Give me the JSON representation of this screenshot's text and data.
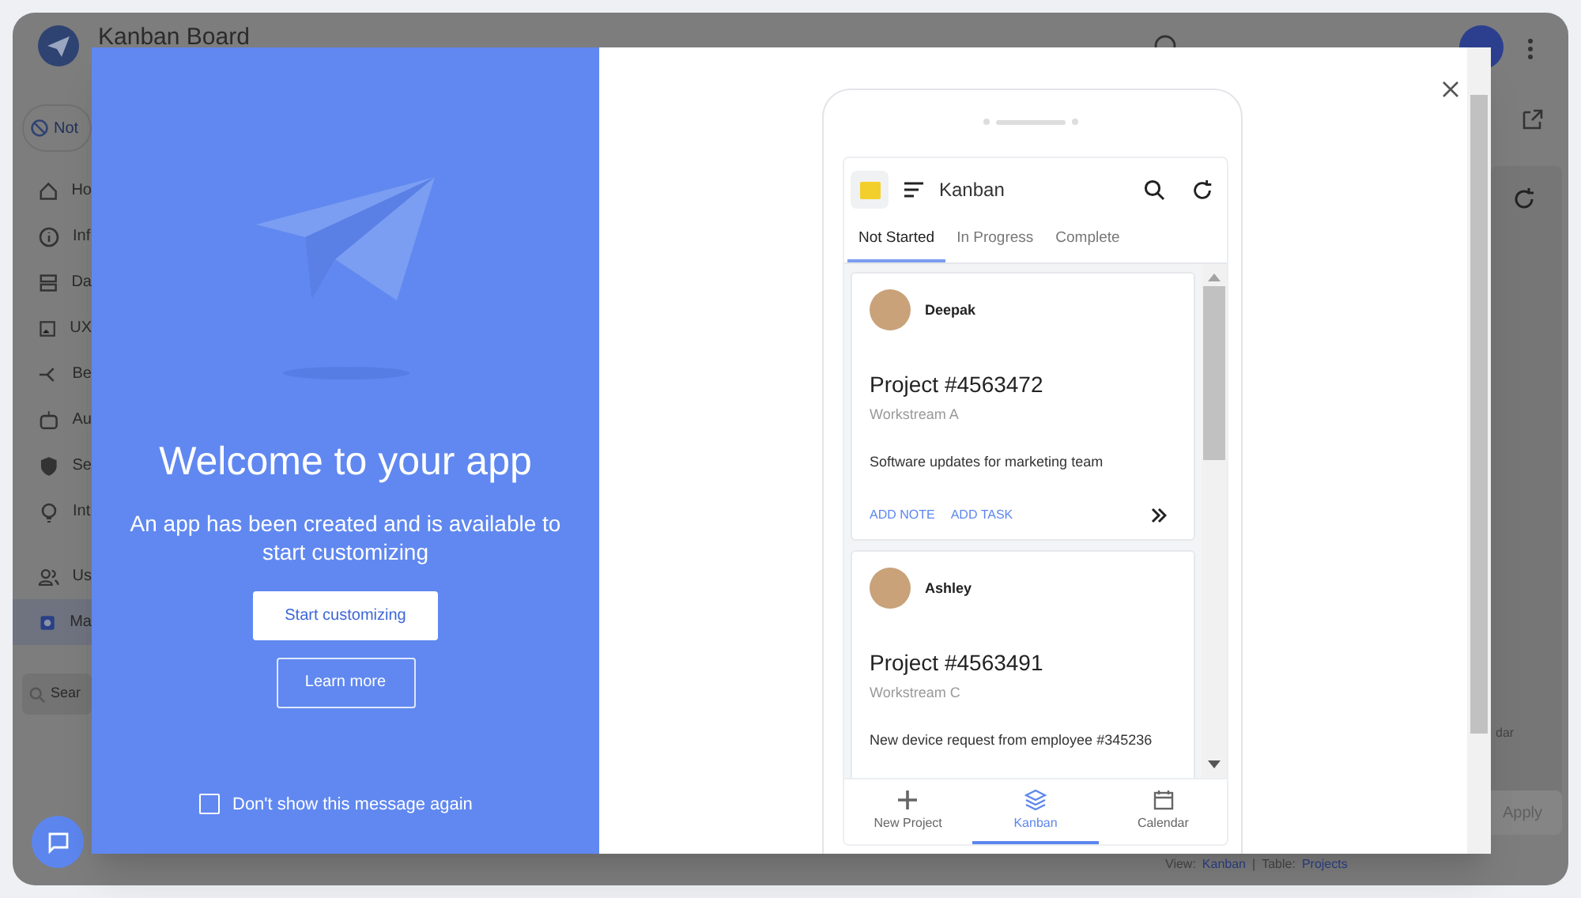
{
  "background_app": {
    "title": "Kanban Board",
    "status_chip": "Not",
    "sidebar": {
      "items": [
        {
          "label": "Ho",
          "selected": false
        },
        {
          "label": "Inf",
          "selected": false
        },
        {
          "label": "Da",
          "selected": false
        },
        {
          "label": "UX",
          "selected": false
        },
        {
          "label": "Be",
          "selected": false
        },
        {
          "label": "Au",
          "selected": false
        },
        {
          "label": "Se",
          "selected": false
        },
        {
          "label": "Int",
          "selected": false
        },
        {
          "label": "Us",
          "selected": false
        },
        {
          "label": "Ma",
          "selected": true
        }
      ],
      "search_placeholder": "Sear"
    },
    "preview": {
      "nav_label": "dar",
      "apply_button": "Apply",
      "view_label": "View:",
      "view": "Kanban",
      "separator": "|",
      "table_label": "Table:",
      "table": "Projects"
    }
  },
  "modal": {
    "title": "Welcome to your app",
    "message": "An app has been created and is available to start customizing",
    "primary_button": "Start customizing",
    "secondary_button": "Learn more",
    "dont_show": {
      "label": "Don't show this message again",
      "checked": false
    },
    "phone": {
      "app_title": "Kanban",
      "tabs": [
        {
          "label": "Not Started",
          "selected": true
        },
        {
          "label": "In Progress",
          "selected": false
        },
        {
          "label": "Complete",
          "selected": false
        }
      ],
      "cards": [
        {
          "name": "Deepak",
          "project": "Project #4563472",
          "workstream": "Workstream A",
          "description": "Software updates for marketing team",
          "actions": [
            "ADD NOTE",
            "ADD TASK"
          ]
        },
        {
          "name": "Ashley",
          "project": "Project #4563491",
          "workstream": "Workstream C",
          "description": "New device request from employee #345236"
        }
      ],
      "nav": [
        {
          "label": "New Project",
          "selected": false
        },
        {
          "label": "Kanban",
          "selected": true
        },
        {
          "label": "Calendar",
          "selected": false
        }
      ]
    }
  }
}
